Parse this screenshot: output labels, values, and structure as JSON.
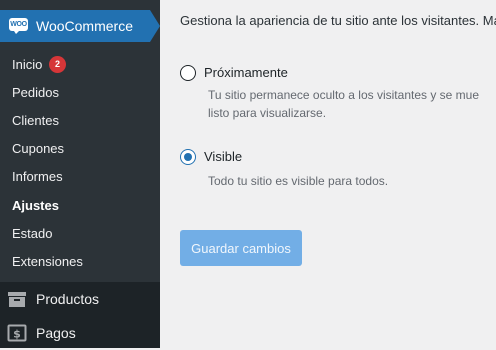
{
  "sidebar": {
    "woocommerce": {
      "logo_text": "WOO",
      "title": "WooCommerce"
    },
    "submenu": [
      {
        "label": "Inicio"
      },
      {
        "label": "Pedidos"
      },
      {
        "label": "Clientes"
      },
      {
        "label": "Cupones"
      },
      {
        "label": "Informes"
      },
      {
        "label": "Ajustes",
        "current": true
      },
      {
        "label": "Estado"
      },
      {
        "label": "Extensiones"
      }
    ],
    "inicio_badge": "2",
    "menu": [
      {
        "label": "Productos",
        "icon": "archive-icon"
      },
      {
        "label": "Pagos",
        "icon": "dollar-icon"
      }
    ]
  },
  "main": {
    "intro": "Gestiona la apariencia de tu sitio ante los visitantes. Má",
    "options": [
      {
        "label": "Próximamente",
        "selected": false,
        "description": [
          "Tu sitio permanece oculto a los visitantes y se mue",
          "listo para visualizarse."
        ]
      },
      {
        "label": "Visible",
        "selected": true,
        "description": [
          "Todo tu sitio es visible para todos."
        ]
      }
    ],
    "save_label": "Guardar cambios"
  },
  "colors": {
    "accent": "#2271b1",
    "sidebar_bg": "#2c3338",
    "badge": "#d63638",
    "button_disabled": "#72aee6"
  }
}
